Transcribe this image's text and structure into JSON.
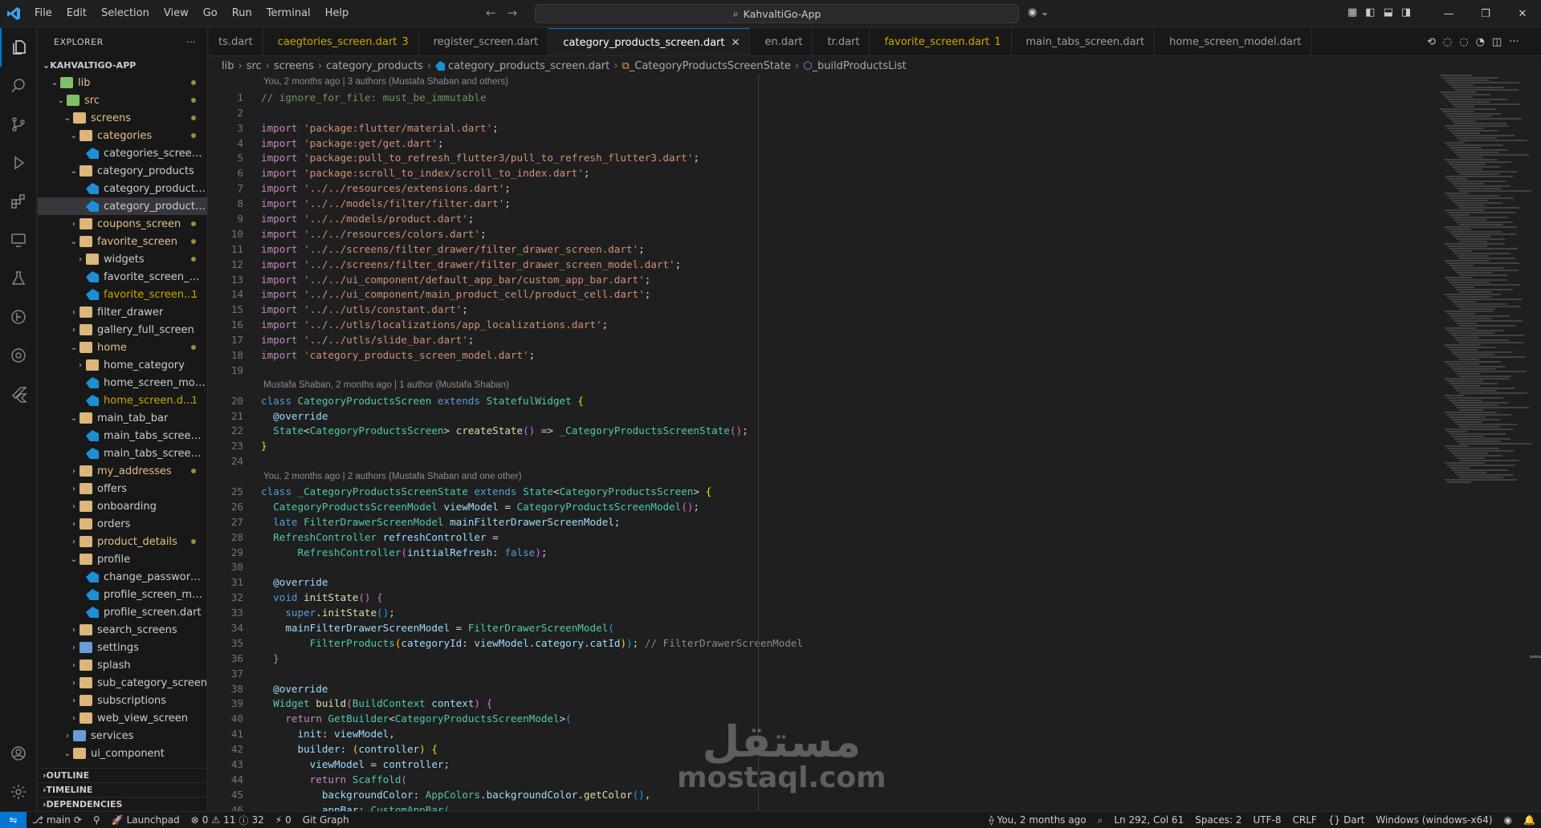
{
  "titlebar": {
    "menu": [
      "File",
      "Edit",
      "Selection",
      "View",
      "Go",
      "Run",
      "Terminal",
      "Help"
    ],
    "search_text": "KahvaltiGo-App"
  },
  "sidebar": {
    "title": "EXPLORER",
    "more": "···",
    "root": "KAHVALTIGO-APP",
    "tree": [
      {
        "depth": 1,
        "kind": "folder",
        "color": "green",
        "open": true,
        "label": "lib",
        "mod": true,
        "dot": true
      },
      {
        "depth": 2,
        "kind": "folder",
        "color": "green",
        "open": true,
        "label": "src",
        "mod": true,
        "dot": true
      },
      {
        "depth": 3,
        "kind": "folder",
        "color": "plain",
        "open": true,
        "label": "screens",
        "mod": true,
        "dot": true
      },
      {
        "depth": 4,
        "kind": "folder",
        "color": "plain",
        "open": true,
        "label": "categories",
        "mod": true,
        "dot": true
      },
      {
        "depth": 5,
        "kind": "dart",
        "label": "categories_screen_..."
      },
      {
        "depth": 4,
        "kind": "folder",
        "color": "plain",
        "open": true,
        "label": "category_products"
      },
      {
        "depth": 5,
        "kind": "dart",
        "label": "category_products_..."
      },
      {
        "depth": 5,
        "kind": "dart",
        "label": "category_products_...",
        "selected": true
      },
      {
        "depth": 4,
        "kind": "folder",
        "color": "plain",
        "open": false,
        "label": "coupons_screen",
        "mod": true,
        "dot": true
      },
      {
        "depth": 4,
        "kind": "folder",
        "color": "plain",
        "open": true,
        "label": "favorite_screen",
        "mod": true,
        "dot": true
      },
      {
        "depth": 5,
        "kind": "folder",
        "color": "plain",
        "open": false,
        "label": "widgets",
        "dot": true
      },
      {
        "depth": 5,
        "kind": "dart",
        "label": "favorite_screen_mo..."
      },
      {
        "depth": 5,
        "kind": "dart",
        "label": "favorite_screen....",
        "warn": true,
        "count": "1"
      },
      {
        "depth": 4,
        "kind": "folder",
        "color": "plain",
        "open": false,
        "label": "filter_drawer"
      },
      {
        "depth": 4,
        "kind": "folder",
        "color": "plain",
        "open": false,
        "label": "gallery_full_screen"
      },
      {
        "depth": 4,
        "kind": "folder",
        "color": "plain",
        "open": true,
        "label": "home",
        "mod": true,
        "dot": true
      },
      {
        "depth": 5,
        "kind": "folder",
        "color": "plain",
        "open": false,
        "label": "home_category"
      },
      {
        "depth": 5,
        "kind": "dart",
        "label": "home_screen_mod..."
      },
      {
        "depth": 5,
        "kind": "dart",
        "label": "home_screen.d...",
        "warn": true,
        "count": "1"
      },
      {
        "depth": 4,
        "kind": "folder",
        "color": "plain",
        "open": true,
        "label": "main_tab_bar"
      },
      {
        "depth": 5,
        "kind": "dart",
        "label": "main_tabs_screen_..."
      },
      {
        "depth": 5,
        "kind": "dart",
        "label": "main_tabs_screen.d..."
      },
      {
        "depth": 4,
        "kind": "folder",
        "color": "plain",
        "open": false,
        "label": "my_addresses",
        "mod": true,
        "dot": true
      },
      {
        "depth": 4,
        "kind": "folder",
        "color": "plain",
        "open": false,
        "label": "offers"
      },
      {
        "depth": 4,
        "kind": "folder",
        "color": "plain",
        "open": false,
        "label": "onboarding"
      },
      {
        "depth": 4,
        "kind": "folder",
        "color": "plain",
        "open": false,
        "label": "orders"
      },
      {
        "depth": 4,
        "kind": "folder",
        "color": "plain",
        "open": false,
        "label": "product_details",
        "mod": true,
        "dot": true
      },
      {
        "depth": 4,
        "kind": "folder",
        "color": "plain",
        "open": true,
        "label": "profile"
      },
      {
        "depth": 5,
        "kind": "dart",
        "label": "change_password_s..."
      },
      {
        "depth": 5,
        "kind": "dart",
        "label": "profile_screen_mod..."
      },
      {
        "depth": 5,
        "kind": "dart",
        "label": "profile_screen.dart"
      },
      {
        "depth": 4,
        "kind": "folder",
        "color": "plain",
        "open": false,
        "label": "search_screens"
      },
      {
        "depth": 4,
        "kind": "folder",
        "color": "blue",
        "open": false,
        "label": "settings"
      },
      {
        "depth": 4,
        "kind": "folder",
        "color": "plain",
        "open": false,
        "label": "splash"
      },
      {
        "depth": 4,
        "kind": "folder",
        "color": "plain",
        "open": false,
        "label": "sub_category_screen"
      },
      {
        "depth": 4,
        "kind": "folder",
        "color": "plain",
        "open": false,
        "label": "subscriptions"
      },
      {
        "depth": 4,
        "kind": "folder",
        "color": "plain",
        "open": false,
        "label": "web_view_screen"
      },
      {
        "depth": 3,
        "kind": "folder",
        "color": "blue",
        "open": false,
        "label": "services"
      },
      {
        "depth": 3,
        "kind": "folder",
        "color": "plain",
        "open": true,
        "label": "ui_component"
      }
    ],
    "sections": [
      "OUTLINE",
      "TIMELINE",
      "DEPENDENCIES"
    ]
  },
  "tabs": [
    {
      "label": "ts.dart",
      "icon": false
    },
    {
      "label": "caegtories_screen.dart",
      "badge": "3",
      "warn": true,
      "icon": true
    },
    {
      "label": "register_screen.dart",
      "icon": true
    },
    {
      "label": "category_products_screen.dart",
      "active": true,
      "icon": true
    },
    {
      "label": "en.dart",
      "icon": true
    },
    {
      "label": "tr.dart",
      "icon": true
    },
    {
      "label": "favorite_screen.dart",
      "badge": "1",
      "warn": true,
      "icon": true
    },
    {
      "label": "main_tabs_screen.dart",
      "icon": true
    },
    {
      "label": "home_screen_model.dart",
      "icon": true
    }
  ],
  "breadcrumb": [
    "lib",
    "src",
    "screens",
    "category_products",
    "category_products_screen.dart",
    "_CategoryProductsScreenState",
    "_buildProductsList"
  ],
  "editor": {
    "blames": {
      "1": "You, 2 months ago | 3 authors (Mustafa Shaban and others)",
      "20": "Mustafa Shaban, 2 months ago | 1 author (Mustafa Shaban)",
      "25": "You, 2 months ago | 2 authors (Mustafa Shaban and one other)"
    },
    "lines": [
      [
        [
          "c-com",
          "// ignore_for_file: must_be_immutable"
        ]
      ],
      [],
      [
        [
          "c-kw2",
          "import "
        ],
        [
          "c-str",
          "'package:flutter/material.dart'"
        ],
        [
          "c-pun",
          ";"
        ]
      ],
      [
        [
          "c-kw2",
          "import "
        ],
        [
          "c-str",
          "'package:get/get.dart'"
        ],
        [
          "c-pun",
          ";"
        ]
      ],
      [
        [
          "c-kw2",
          "import "
        ],
        [
          "c-str",
          "'package:pull_to_refresh_flutter3/pull_to_refresh_flutter3.dart'"
        ],
        [
          "c-pun",
          ";"
        ]
      ],
      [
        [
          "c-kw2",
          "import "
        ],
        [
          "c-str",
          "'package:scroll_to_index/scroll_to_index.dart'"
        ],
        [
          "c-pun",
          ";"
        ]
      ],
      [
        [
          "c-kw2",
          "import "
        ],
        [
          "c-str",
          "'../../resources/extensions.dart'"
        ],
        [
          "c-pun",
          ";"
        ]
      ],
      [
        [
          "c-kw2",
          "import "
        ],
        [
          "c-str",
          "'../../models/filter/filter.dart'"
        ],
        [
          "c-pun",
          ";"
        ]
      ],
      [
        [
          "c-kw2",
          "import "
        ],
        [
          "c-str",
          "'../../models/product.dart'"
        ],
        [
          "c-pun",
          ";"
        ]
      ],
      [
        [
          "c-kw2",
          "import "
        ],
        [
          "c-str",
          "'../../resources/colors.dart'"
        ],
        [
          "c-pun",
          ";"
        ]
      ],
      [
        [
          "c-kw2",
          "import "
        ],
        [
          "c-str",
          "'../../screens/filter_drawer/filter_drawer_screen.dart'"
        ],
        [
          "c-pun",
          ";"
        ]
      ],
      [
        [
          "c-kw2",
          "import "
        ],
        [
          "c-str",
          "'../../screens/filter_drawer/filter_drawer_screen_model.dart'"
        ],
        [
          "c-pun",
          ";"
        ]
      ],
      [
        [
          "c-kw2",
          "import "
        ],
        [
          "c-str",
          "'../../ui_component/default_app_bar/custom_app_bar.dart'"
        ],
        [
          "c-pun",
          ";"
        ]
      ],
      [
        [
          "c-kw2",
          "import "
        ],
        [
          "c-str",
          "'../../ui_component/main_product_cell/product_cell.dart'"
        ],
        [
          "c-pun",
          ";"
        ]
      ],
      [
        [
          "c-kw2",
          "import "
        ],
        [
          "c-str",
          "'../../utls/constant.dart'"
        ],
        [
          "c-pun",
          ";"
        ]
      ],
      [
        [
          "c-kw2",
          "import "
        ],
        [
          "c-str",
          "'../../utls/localizations/app_localizations.dart'"
        ],
        [
          "c-pun",
          ";"
        ]
      ],
      [
        [
          "c-kw2",
          "import "
        ],
        [
          "c-str",
          "'../../utls/slide_bar.dart'"
        ],
        [
          "c-pun",
          ";"
        ]
      ],
      [
        [
          "c-kw2",
          "import "
        ],
        [
          "c-str",
          "'category_products_screen_model.dart'"
        ],
        [
          "c-pun",
          ";"
        ]
      ],
      [],
      [
        [
          "c-kw",
          "class "
        ],
        [
          "c-typ",
          "CategoryProductsScreen "
        ],
        [
          "c-kw",
          "extends "
        ],
        [
          "c-typ",
          "StatefulWidget "
        ],
        [
          "c-br1",
          "{"
        ]
      ],
      [
        [
          "c-pun",
          "  "
        ],
        [
          "c-var",
          "@override"
        ]
      ],
      [
        [
          "c-pun",
          "  "
        ],
        [
          "c-typ",
          "State"
        ],
        [
          "c-pun",
          "<"
        ],
        [
          "c-typ",
          "CategoryProductsScreen"
        ],
        [
          "c-pun",
          "> "
        ],
        [
          "c-fn",
          "createState"
        ],
        [
          "c-br2",
          "()"
        ],
        [
          "c-pun",
          " => "
        ],
        [
          "c-typ",
          "_CategoryProductsScreenState"
        ],
        [
          "c-br2",
          "()"
        ],
        [
          "c-pun",
          ";"
        ]
      ],
      [
        [
          "c-br1",
          "}"
        ]
      ],
      [],
      [
        [
          "c-kw",
          "class "
        ],
        [
          "c-typ",
          "_CategoryProductsScreenState "
        ],
        [
          "c-kw",
          "extends "
        ],
        [
          "c-typ",
          "State"
        ],
        [
          "c-pun",
          "<"
        ],
        [
          "c-typ",
          "CategoryProductsScreen"
        ],
        [
          "c-pun",
          "> "
        ],
        [
          "c-br1",
          "{"
        ]
      ],
      [
        [
          "c-pun",
          "  "
        ],
        [
          "c-typ",
          "CategoryProductsScreenModel "
        ],
        [
          "c-var",
          "viewModel"
        ],
        [
          "c-pun",
          " = "
        ],
        [
          "c-typ",
          "CategoryProductsScreenModel"
        ],
        [
          "c-br2",
          "()"
        ],
        [
          "c-pun",
          ";"
        ]
      ],
      [
        [
          "c-pun",
          "  "
        ],
        [
          "c-kw",
          "late "
        ],
        [
          "c-typ",
          "FilterDrawerScreenModel "
        ],
        [
          "c-var",
          "mainFilterDrawerScreenModel"
        ],
        [
          "c-pun",
          ";"
        ]
      ],
      [
        [
          "c-pun",
          "  "
        ],
        [
          "c-typ",
          "RefreshController "
        ],
        [
          "c-var",
          "refreshController"
        ],
        [
          "c-pun",
          " ="
        ]
      ],
      [
        [
          "c-pun",
          "      "
        ],
        [
          "c-typ",
          "RefreshController"
        ],
        [
          "c-br2",
          "("
        ],
        [
          "c-var",
          "initialRefresh"
        ],
        [
          "c-pun",
          ": "
        ],
        [
          "c-kw",
          "false"
        ],
        [
          "c-br2",
          ")"
        ],
        [
          "c-pun",
          ";"
        ]
      ],
      [],
      [
        [
          "c-pun",
          "  "
        ],
        [
          "c-var",
          "@override"
        ]
      ],
      [
        [
          "c-pun",
          "  "
        ],
        [
          "c-kw",
          "void "
        ],
        [
          "c-fn",
          "initState"
        ],
        [
          "c-br2",
          "() {"
        ]
      ],
      [
        [
          "c-pun",
          "    "
        ],
        [
          "c-kw",
          "super"
        ],
        [
          "c-pun",
          "."
        ],
        [
          "c-fn",
          "initState"
        ],
        [
          "c-br3",
          "()"
        ],
        [
          "c-pun",
          ";"
        ]
      ],
      [
        [
          "c-pun",
          "    "
        ],
        [
          "c-var",
          "mainFilterDrawerScreenModel"
        ],
        [
          "c-pun",
          " = "
        ],
        [
          "c-typ",
          "FilterDrawerScreenModel"
        ],
        [
          "c-br3",
          "("
        ]
      ],
      [
        [
          "c-pun",
          "        "
        ],
        [
          "c-typ",
          "FilterProducts"
        ],
        [
          "c-br1",
          "("
        ],
        [
          "c-var",
          "categoryId"
        ],
        [
          "c-pun",
          ": "
        ],
        [
          "c-var",
          "viewModel"
        ],
        [
          "c-pun",
          "."
        ],
        [
          "c-var",
          "category"
        ],
        [
          "c-pun",
          "."
        ],
        [
          "c-var",
          "catId"
        ],
        [
          "c-br1",
          ")"
        ],
        [
          "c-br3",
          ")"
        ],
        [
          "c-pun",
          "; "
        ],
        [
          "c-hint",
          "// FilterDrawerScreenModel"
        ]
      ],
      [
        [
          "c-pun",
          "  "
        ],
        [
          "c-br2",
          "}"
        ]
      ],
      [],
      [
        [
          "c-pun",
          "  "
        ],
        [
          "c-var",
          "@override"
        ]
      ],
      [
        [
          "c-pun",
          "  "
        ],
        [
          "c-typ",
          "Widget "
        ],
        [
          "c-fn",
          "build"
        ],
        [
          "c-br2",
          "("
        ],
        [
          "c-typ",
          "BuildContext "
        ],
        [
          "c-var",
          "context"
        ],
        [
          "c-br2",
          ") {"
        ]
      ],
      [
        [
          "c-pun",
          "    "
        ],
        [
          "c-kw2",
          "return "
        ],
        [
          "c-typ",
          "GetBuilder"
        ],
        [
          "c-pun",
          "<"
        ],
        [
          "c-typ",
          "CategoryProductsScreenModel"
        ],
        [
          "c-pun",
          ">"
        ],
        [
          "c-br3",
          "("
        ]
      ],
      [
        [
          "c-pun",
          "      "
        ],
        [
          "c-var",
          "init"
        ],
        [
          "c-pun",
          ": "
        ],
        [
          "c-var",
          "viewModel"
        ],
        [
          "c-pun",
          ","
        ]
      ],
      [
        [
          "c-pun",
          "      "
        ],
        [
          "c-var",
          "builder"
        ],
        [
          "c-pun",
          ": "
        ],
        [
          "c-br1",
          "("
        ],
        [
          "c-var",
          "controller"
        ],
        [
          "c-br1",
          ")"
        ],
        [
          "c-pun",
          " "
        ],
        [
          "c-br1",
          "{"
        ]
      ],
      [
        [
          "c-pun",
          "        "
        ],
        [
          "c-var",
          "viewModel"
        ],
        [
          "c-pun",
          " = "
        ],
        [
          "c-var",
          "controller"
        ],
        [
          "c-pun",
          ";"
        ]
      ],
      [
        [
          "c-pun",
          "        "
        ],
        [
          "c-kw2",
          "return "
        ],
        [
          "c-typ",
          "Scaffold"
        ],
        [
          "c-br2",
          "("
        ]
      ],
      [
        [
          "c-pun",
          "          "
        ],
        [
          "c-var",
          "backgroundColor"
        ],
        [
          "c-pun",
          ": "
        ],
        [
          "c-typ",
          "AppColors"
        ],
        [
          "c-pun",
          "."
        ],
        [
          "c-var",
          "backgroundColor"
        ],
        [
          "c-pun",
          "."
        ],
        [
          "c-fn",
          "getColor"
        ],
        [
          "c-br3",
          "()"
        ],
        [
          "c-pun",
          ","
        ]
      ],
      [
        [
          "c-pun",
          "          "
        ],
        [
          "c-var",
          "appBar"
        ],
        [
          "c-pun",
          ": "
        ],
        [
          "c-typ",
          "CustomAppBar"
        ],
        [
          "c-br3",
          "("
        ]
      ]
    ]
  },
  "watermark": {
    "arabic": "مستقل",
    "latin": "mostaql.com"
  },
  "statusbar": {
    "branch": "main",
    "launchpad": "Launchpad",
    "errors": "0",
    "warnings": "11",
    "info": "32",
    "ports": "0",
    "git_graph": "Git Graph",
    "blame": "You, 2 months ago",
    "position": "Ln 292, Col 61",
    "spaces": "Spaces: 2",
    "encoding": "UTF-8",
    "eol": "CRLF",
    "language": "Dart",
    "platform": "Windows (windows-x64)"
  }
}
